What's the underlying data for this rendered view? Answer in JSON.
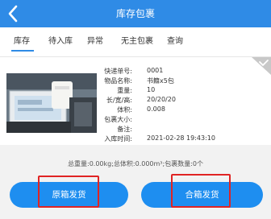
{
  "header": {
    "title": "库存包裹"
  },
  "tabs": [
    "库存",
    "待入库",
    "异常",
    "无主包裹",
    "查询"
  ],
  "package": {
    "photo_icon": "package-photo",
    "fields": [
      {
        "label": "快递单号:",
        "value": "0001"
      },
      {
        "label": "物品名称:",
        "value": "书籍x5包"
      },
      {
        "label": "重量:",
        "value": "10"
      },
      {
        "label": "长/宽/高:",
        "value": "20/20/20"
      },
      {
        "label": "体积:",
        "value": "0.008"
      },
      {
        "label": "包裹大小:",
        "value": ""
      },
      {
        "label": "备注:",
        "value": ""
      },
      {
        "label": "入库时间:",
        "value": "2021-02-28 19:43:10"
      }
    ]
  },
  "summary": "总重量:0.00kg;总体积:0.000m³;包裹数量:0个",
  "buttons": {
    "ship_original": "原箱发货",
    "ship_combined": "合箱发货"
  },
  "colors": {
    "accent": "#2f8be6",
    "button": "#1e8ef0",
    "highlight": "#e02424"
  }
}
